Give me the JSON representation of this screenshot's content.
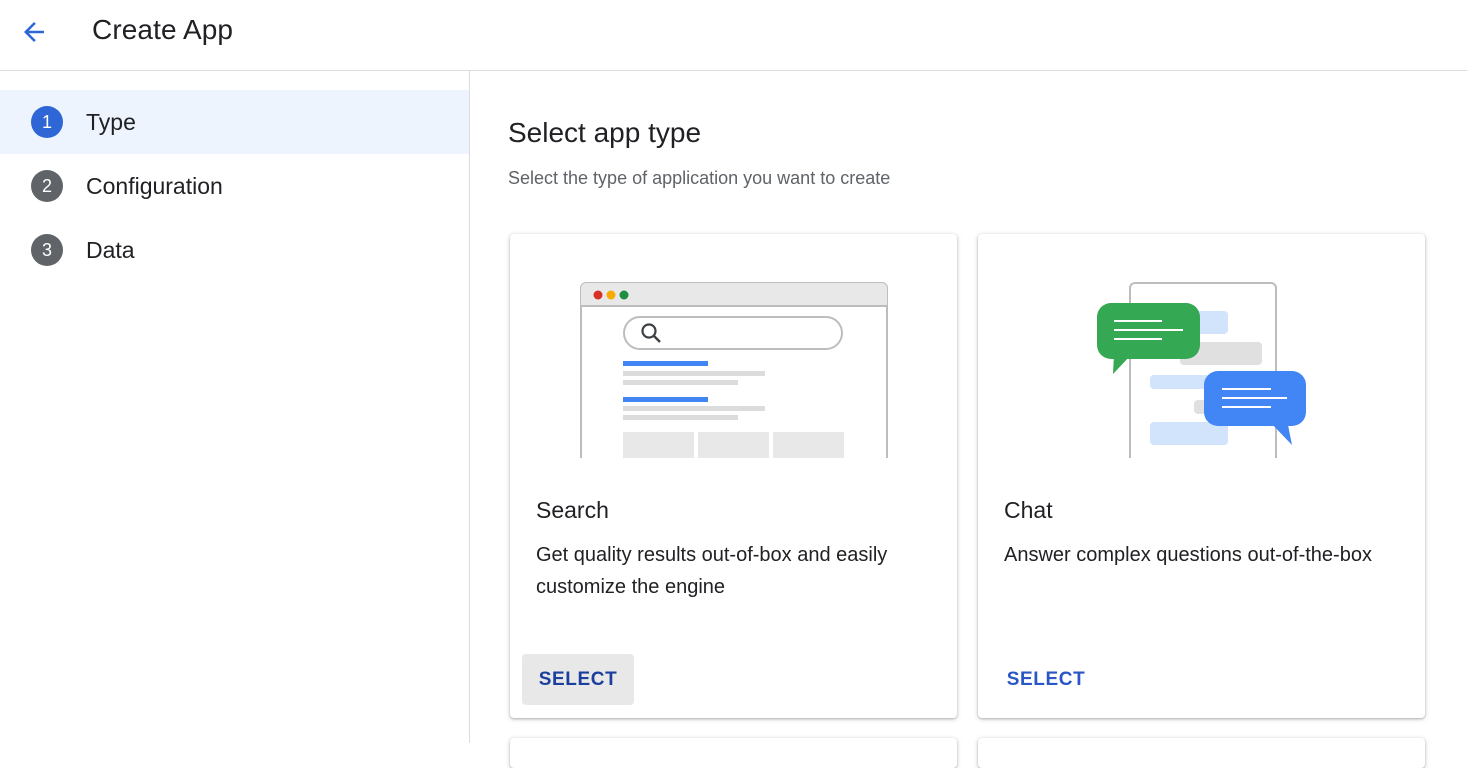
{
  "header": {
    "title": "Create App",
    "back_icon": "arrow-left-icon"
  },
  "stepper": {
    "steps": [
      {
        "number": "1",
        "label": "Type",
        "active": true
      },
      {
        "number": "2",
        "label": "Configuration",
        "active": false
      },
      {
        "number": "3",
        "label": "Data",
        "active": false
      }
    ]
  },
  "main": {
    "title": "Select app type",
    "subtitle": "Select the type of application you want to create",
    "cards": [
      {
        "title": "Search",
        "description": "Get quality results out-of-box and easily customize the engine",
        "button_label": "SELECT",
        "illustration": "search-browser-illustration"
      },
      {
        "title": "Chat",
        "description": "Answer complex questions out-of-the-box",
        "button_label": "SELECT",
        "illustration": "chat-bubbles-illustration"
      }
    ]
  },
  "colors": {
    "accent": "#2e66d6",
    "active_step_bg": "#eef4fe",
    "chat_green": "#34a853",
    "chat_blue": "#4285f4"
  }
}
